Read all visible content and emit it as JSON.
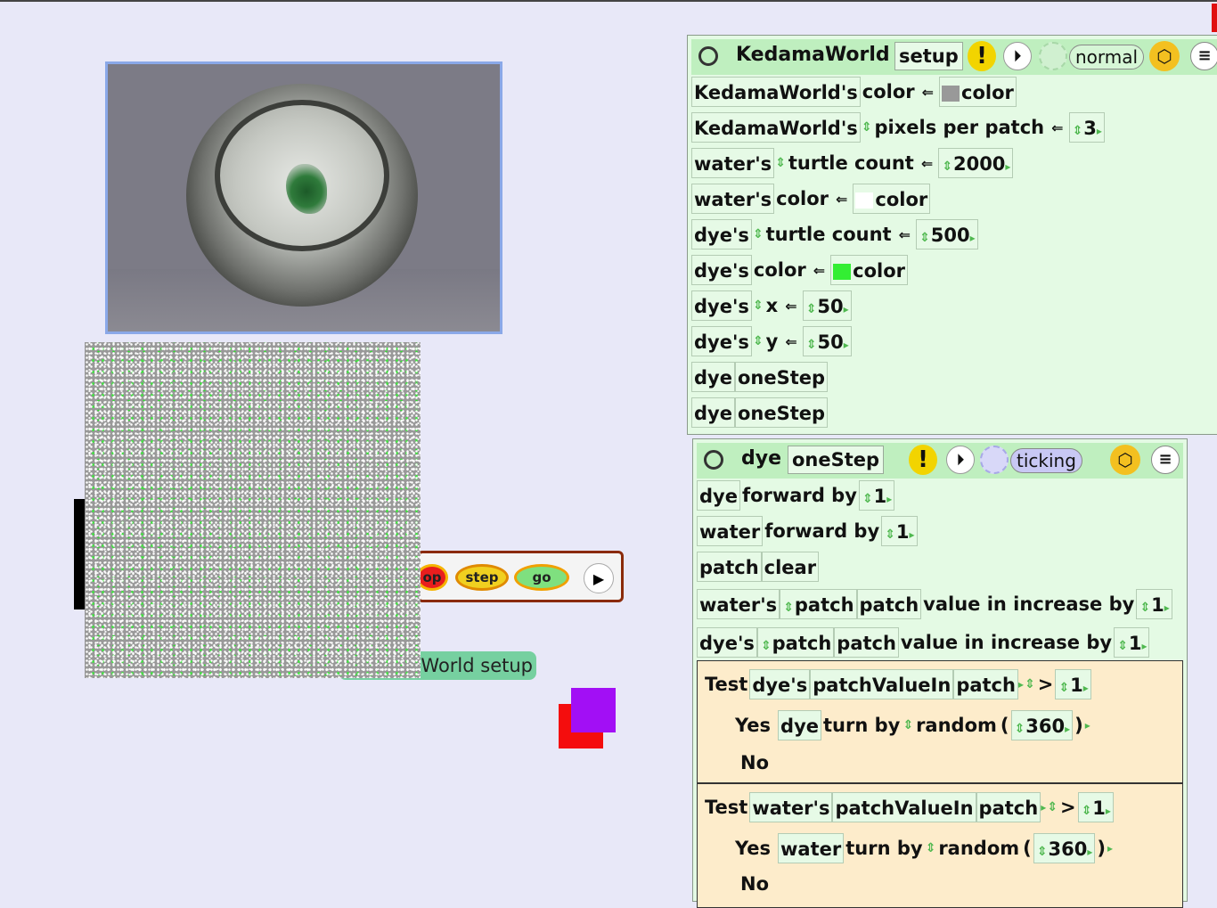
{
  "playfield": {
    "world_setup_label": "World setup",
    "controls": {
      "stop_label": "op",
      "step_label": "step",
      "go_label": "go"
    }
  },
  "colors": {
    "background": "#e8e8f8",
    "script_bg": "#e4fae4",
    "script_header": "#bfefbf",
    "test_bg": "#fdeccb",
    "kedama_world_color": "#999999",
    "water_color": "#ffffff",
    "dye_color": "#33ee33",
    "red_square": "#f40d0d",
    "purple_square": "#a20ff5"
  },
  "script1": {
    "object": "KedamaWorld",
    "name": "setup",
    "mode": "normal",
    "rows": [
      {
        "subject": "KedamaWorld's",
        "property": "color",
        "value": "color"
      },
      {
        "subject": "KedamaWorld's",
        "property": "pixels per patch",
        "value": "3"
      },
      {
        "subject": "water's",
        "property": "turtle count",
        "value": "2000"
      },
      {
        "subject": "water's",
        "property": "color",
        "value": "color"
      },
      {
        "subject": "dye's",
        "property": "turtle count",
        "value": "500"
      },
      {
        "subject": "dye's",
        "property": "color",
        "value": "color"
      },
      {
        "subject": "dye's",
        "property": "x",
        "value": "50"
      },
      {
        "subject": "dye's",
        "property": "y",
        "value": "50"
      },
      {
        "subject": "dye",
        "command": "oneStep"
      },
      {
        "subject": "dye",
        "command": "oneStep"
      }
    ]
  },
  "script2": {
    "object": "dye",
    "name": "oneStep",
    "mode": "ticking",
    "rows": [
      {
        "subject": "dye",
        "command": "forward by",
        "value": "1"
      },
      {
        "subject": "water",
        "command": "forward by",
        "value": "1"
      },
      {
        "subject": "patch",
        "command": "clear"
      },
      {
        "subject": "water's",
        "target": "patch",
        "param": "patch",
        "command": "value in increase by",
        "value": "1"
      },
      {
        "subject": "dye's",
        "target": "patch",
        "param": "patch",
        "command": "value in increase by",
        "value": "1"
      }
    ],
    "tests": [
      {
        "test_label": "Test",
        "subject": "dye's",
        "getter": "patchValueIn",
        "arg": "patch",
        "op": ">",
        "compare": "1",
        "yes_label": "Yes",
        "yes_subject": "dye",
        "yes_command": "turn by",
        "random": "random",
        "random_value": "360",
        "open_paren": "(",
        "close_paren": ")",
        "no_label": "No"
      },
      {
        "test_label": "Test",
        "subject": "water's",
        "getter": "patchValueIn",
        "arg": "patch",
        "op": ">",
        "compare": "1",
        "yes_label": "Yes",
        "yes_subject": "water",
        "yes_command": "turn by",
        "random": "random",
        "random_value": "360",
        "open_paren": "(",
        "close_paren": ")",
        "no_label": "No"
      }
    ]
  }
}
